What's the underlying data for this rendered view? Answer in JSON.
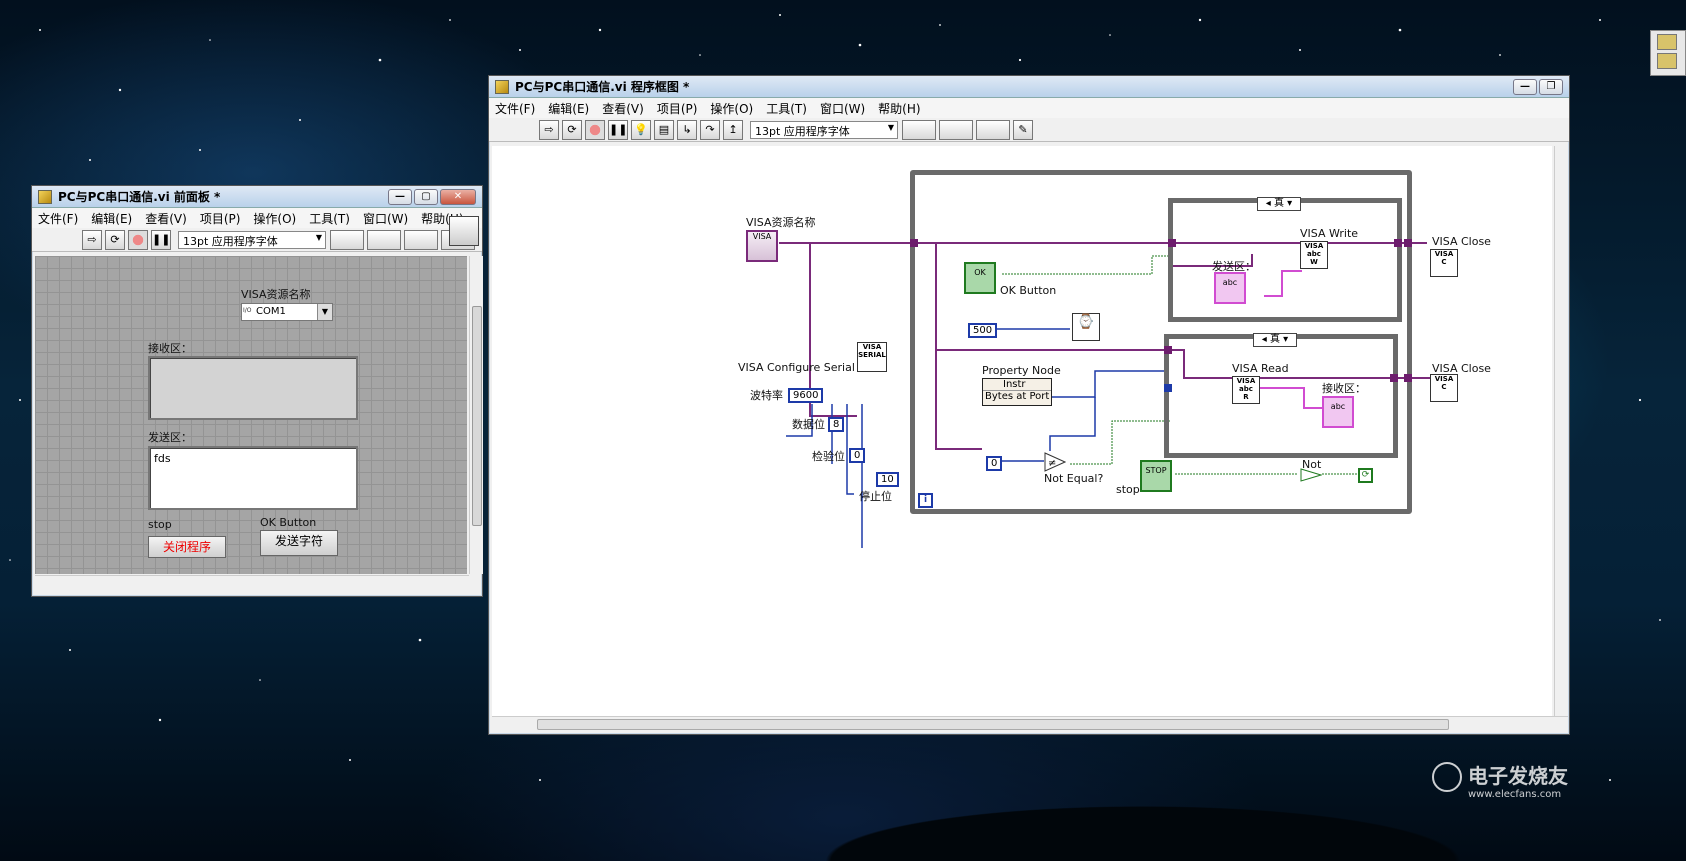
{
  "colors": {
    "visa_wire": "#7a2a7a",
    "numeric_wire": "#1d3aa8",
    "bool_wire": "#1f7a1f",
    "string_wire": "#d14cd1"
  },
  "front_panel": {
    "title": "PC与PC串口通信.vi 前面板 *",
    "menus": [
      "文件(F)",
      "编辑(E)",
      "查看(V)",
      "项目(P)",
      "操作(O)",
      "工具(T)",
      "窗口(W)",
      "帮助(H)"
    ],
    "font_select": "13pt 应用程序字体",
    "visa_label": "VISA资源名称",
    "visa_value": "COM1",
    "receive_label": "接收区：",
    "receive_value": "",
    "send_label": "发送区：",
    "send_value": "fds",
    "stop_label": "stop",
    "stop_button": "关闭程序",
    "ok_label": "OK Button",
    "ok_button": "发送字符"
  },
  "block_diagram": {
    "title": "PC与PC串口通信.vi 程序框图 *",
    "menus": [
      "文件(F)",
      "编辑(E)",
      "查看(V)",
      "项目(P)",
      "操作(O)",
      "工具(T)",
      "窗口(W)",
      "帮助(H)"
    ],
    "font_select": "13pt 应用程序字体",
    "visa_label": "VISA资源名称",
    "visa_terminal": "VISA",
    "configure_label": "VISA Configure Serial Port",
    "baud_label": "波特率",
    "baud_value": "9600",
    "databits_label": "数据位",
    "databits_value": "8",
    "parity_label": "检验位",
    "parity_value": "0",
    "stopbits_label": "停止位",
    "stopbits_value": "10",
    "ok_button_label": "OK Button",
    "ok_terminal": "OK",
    "wait_value": "500",
    "property_node_label": "Property Node",
    "property_instr": "Instr",
    "property_bytes": "Bytes at Port",
    "zero_value": "0",
    "not_equal_label": "Not Equal?",
    "stop_label": "stop",
    "stop_terminal": "STOP",
    "not_label": "Not",
    "case_true_1": "真",
    "case_true_2": "真",
    "send_label": "发送区：",
    "recv_label": "接收区：",
    "visa_write_label": "VISA Write",
    "visa_read_label": "VISA Read",
    "visa_close_1": "VISA Close",
    "visa_close_2": "VISA Close",
    "iteration": "i"
  },
  "watermark": {
    "brand": "电子发烧友",
    "url": "www.elecfans.com"
  }
}
